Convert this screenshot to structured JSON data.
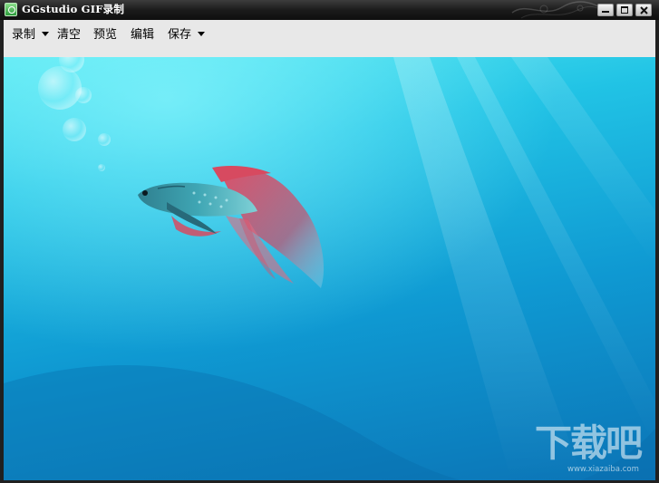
{
  "window": {
    "title": "GGstudio GIF录制",
    "buttons": {
      "minimize_icon": "minimize-icon",
      "maximize_icon": "maximize-icon",
      "close_icon": "close-icon"
    }
  },
  "toolbar": {
    "items": [
      {
        "label": "录制",
        "has_dropdown": true
      },
      {
        "label": "清空",
        "has_dropdown": false
      },
      {
        "label": "预览",
        "has_dropdown": false
      },
      {
        "label": "编辑",
        "has_dropdown": false
      },
      {
        "label": "保存",
        "has_dropdown": true
      }
    ]
  },
  "canvas": {
    "content": "betta-fish-wallpaper"
  },
  "watermark": {
    "logo": "下载吧",
    "url": "www.xiazaiba.com"
  },
  "colors": {
    "titlebar": "#1b1b1b",
    "toolbar": "#e8e8e8",
    "canvas_light": "#4fe6f0",
    "canvas_dark": "#0b74b6"
  }
}
